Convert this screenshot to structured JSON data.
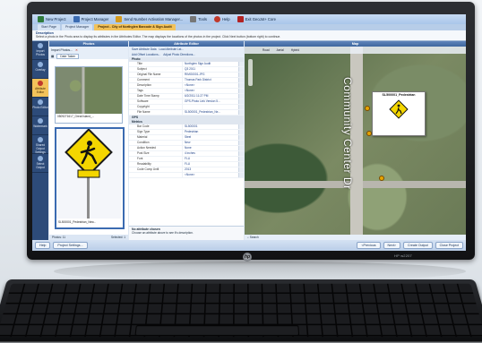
{
  "toolbar": {
    "items": [
      {
        "label": "New Project",
        "icon": "new-project-icon",
        "color": "#2f7a3c"
      },
      {
        "label": "Project Manager",
        "icon": "project-manager-icon",
        "color": "#3b6bb1"
      },
      {
        "label": "Send Number Activation Manager...",
        "icon": "send-number-icon",
        "color": "#d49a1e"
      },
      {
        "label": "Tools",
        "icon": "tools-icon",
        "color": "#777777"
      },
      {
        "label": "Help",
        "icon": "help-icon",
        "color": "#c0392b"
      },
      {
        "label": "Exit GeoJot+ Core",
        "icon": "exit-icon",
        "color": "#b22222"
      }
    ]
  },
  "tabs": [
    {
      "label": "Start Page"
    },
    {
      "label": "Project Manager"
    },
    {
      "label": "Project - City of Northglen Barcode & Sign Audit",
      "active": true
    }
  ],
  "description": {
    "label": "Description",
    "text": "Select a photo in the Photo area to display its attributes in the Attributes Editor. The map displays the locations of the photos in the project. Click Next button (bottom right) to continue."
  },
  "leftnav": [
    {
      "label": "Import Photos"
    },
    {
      "label": "Overlay"
    },
    {
      "label": "Attribute Editor",
      "active": true
    },
    {
      "label": "Photo Editor"
    },
    {
      "label": "Watermark"
    },
    {
      "label": "Shared Output Settings"
    },
    {
      "label": "Select Output"
    }
  ],
  "photos": {
    "title": "Photos",
    "toolbar": {
      "import_label": "Import Photos...",
      "sort_label": "Date Taken"
    },
    "thumbs": [
      {
        "caption": "0509271617_Great Island_..."
      },
      {
        "caption": "SL500001_Pedestrian_New..."
      }
    ],
    "footer": {
      "count": "Photos: 11",
      "selected": "Selected: 1"
    }
  },
  "attributes": {
    "title": "Attribute Editor",
    "toolbar1": {
      "save": "Save Attribute Data",
      "load": "Load Attribute Lst..."
    },
    "toolbar2": {
      "add": "Add Offset Locations...",
      "adjust": "Adjust Photo Directions..."
    },
    "sections": {
      "photo": "Photo",
      "gps": "GPS",
      "metrics": "Metrics"
    },
    "photo_rows": [
      {
        "k": "Title",
        "v": "Northglen Sign Audit"
      },
      {
        "k": "Subject",
        "v": "Q3 2011"
      },
      {
        "k": "Original File Name",
        "v": "RIMG0001.JPG"
      },
      {
        "k": "Comment",
        "v": "Thomas Park District"
      },
      {
        "k": "Description",
        "v": "<None>"
      },
      {
        "k": "Tags",
        "v": "<None>"
      },
      {
        "k": "Date Time Stamp",
        "v": "6/2/2011 11:27 PM"
      },
      {
        "k": "Software",
        "v": "GPS-Photo Link Version 5..."
      },
      {
        "k": "Copyright",
        "v": ""
      },
      {
        "k": "File Name",
        "v": "SL500001_Pedestrian_Ne..."
      }
    ],
    "metric_rows": [
      {
        "k": "Bar Code",
        "v": "SL500001"
      },
      {
        "k": "Sign Type",
        "v": "Pedestrian"
      },
      {
        "k": "Material",
        "v": "Steel"
      },
      {
        "k": "Condition",
        "v": "New"
      },
      {
        "k": "Action Needed",
        "v": "None"
      },
      {
        "k": "Post Size",
        "v": "4 inches"
      },
      {
        "k": "Font",
        "v": "FLU"
      },
      {
        "k": "Readability",
        "v": "FLU"
      },
      {
        "k": "Code Comp Until",
        "v": "2013"
      },
      {
        "k": "",
        "v": "<None>"
      }
    ],
    "desc_title": "No attribute chosen",
    "desc_text": "Choose an attribute above to see it's description."
  },
  "map": {
    "title": "Map",
    "tools": [
      "Road",
      "Aerial",
      "Hybrid"
    ],
    "street_label": "Community Center Dr",
    "popup_title": "SL500001_Pedestrian",
    "search": "Search"
  },
  "statusbar": {
    "help": "Help",
    "settings": "Project Settings...",
    "previous": "<Previous",
    "next": "Next>",
    "create_output": "Create Output",
    "close_project": "Close Project"
  },
  "monitor": {
    "brand": "hp",
    "model": "HP w2207"
  },
  "colors": {
    "accent": "#f2c25a",
    "header": "#3e679f",
    "sign_yellow": "#f4d600"
  }
}
